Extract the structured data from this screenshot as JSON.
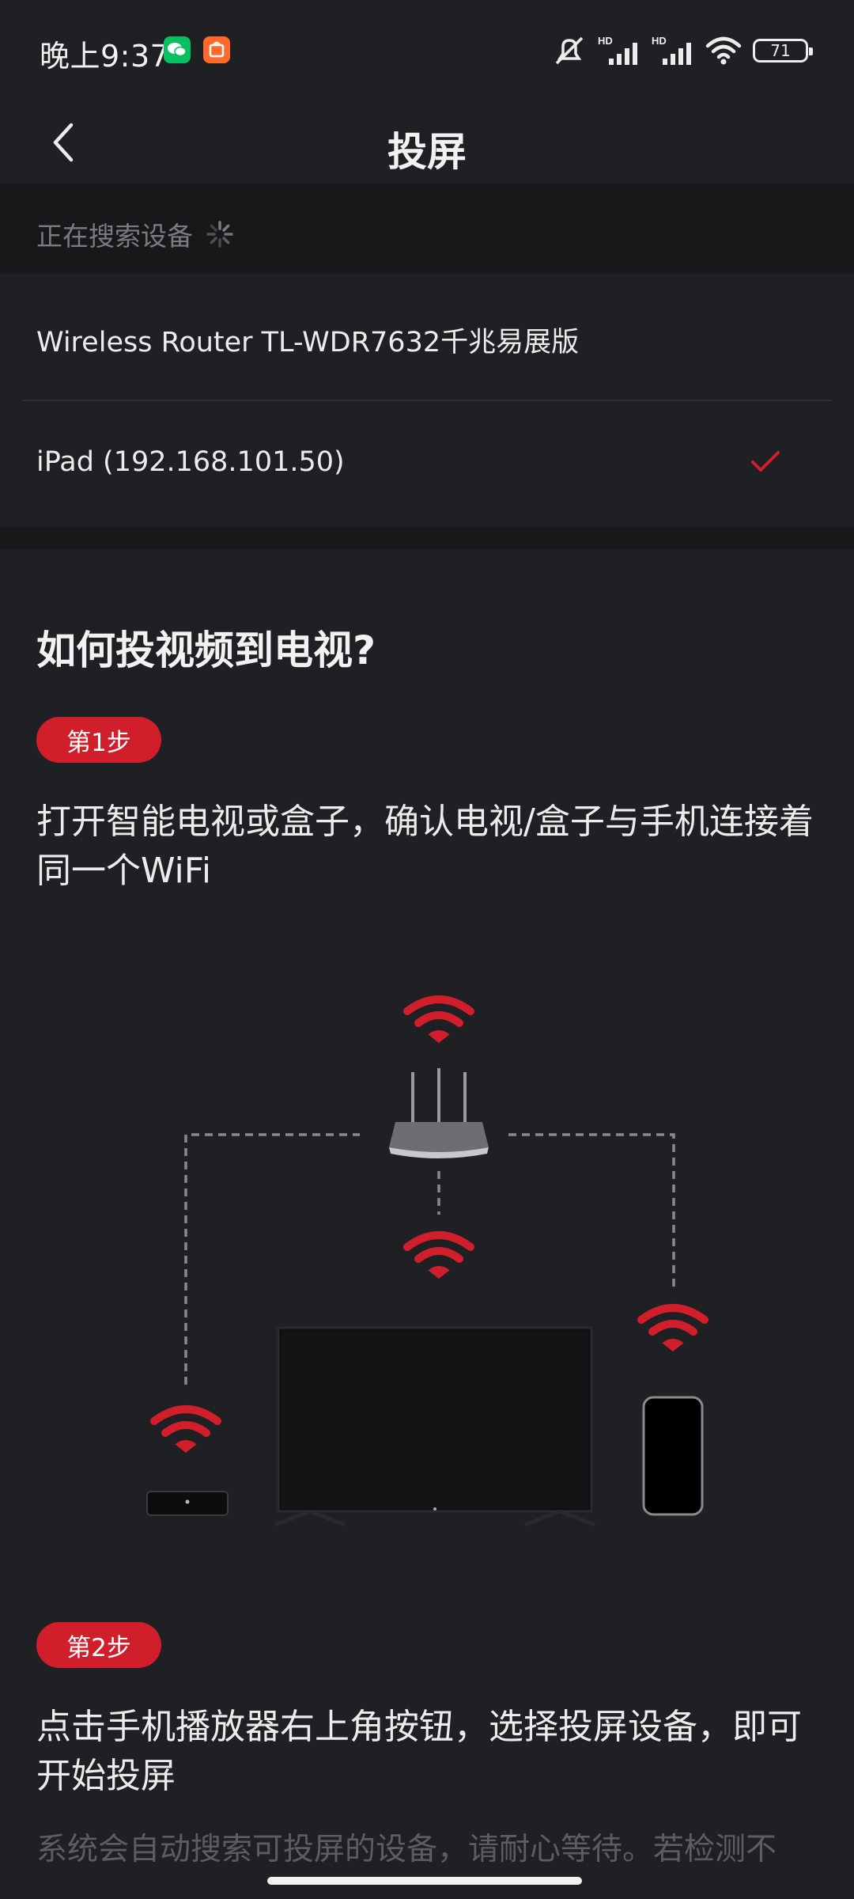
{
  "status_bar": {
    "time": "晚上9:37",
    "battery": "71",
    "icons": [
      "wechat-icon",
      "mi-store-icon",
      "mute-icon",
      "hd-signal-icon",
      "hd-signal-icon",
      "wifi-icon",
      "battery-icon"
    ]
  },
  "header": {
    "title": "投屏",
    "back_icon": "chevron-left-icon"
  },
  "search": {
    "status_text": "正在搜索设备"
  },
  "devices": [
    {
      "label": "Wireless Router TL-WDR7632千兆易展版",
      "selected": false
    },
    {
      "label": "iPad (192.168.101.50)",
      "selected": true
    }
  ],
  "guide": {
    "title": "如何投视频到电视?",
    "steps": [
      {
        "badge": "第1步",
        "text": "打开智能电视或盒子，确认电视/盒子与手机连接着同一个WiFi"
      },
      {
        "badge": "第2步",
        "text": "点击手机播放器右上角按钮，选择投屏设备，即可开始投屏"
      }
    ],
    "note": "系统会自动搜索可投屏的设备，请耐心等待。若检测不"
  },
  "colors": {
    "background": "#1f2023",
    "accent": "#d01e2b",
    "muted_text": "#7c7c80"
  }
}
